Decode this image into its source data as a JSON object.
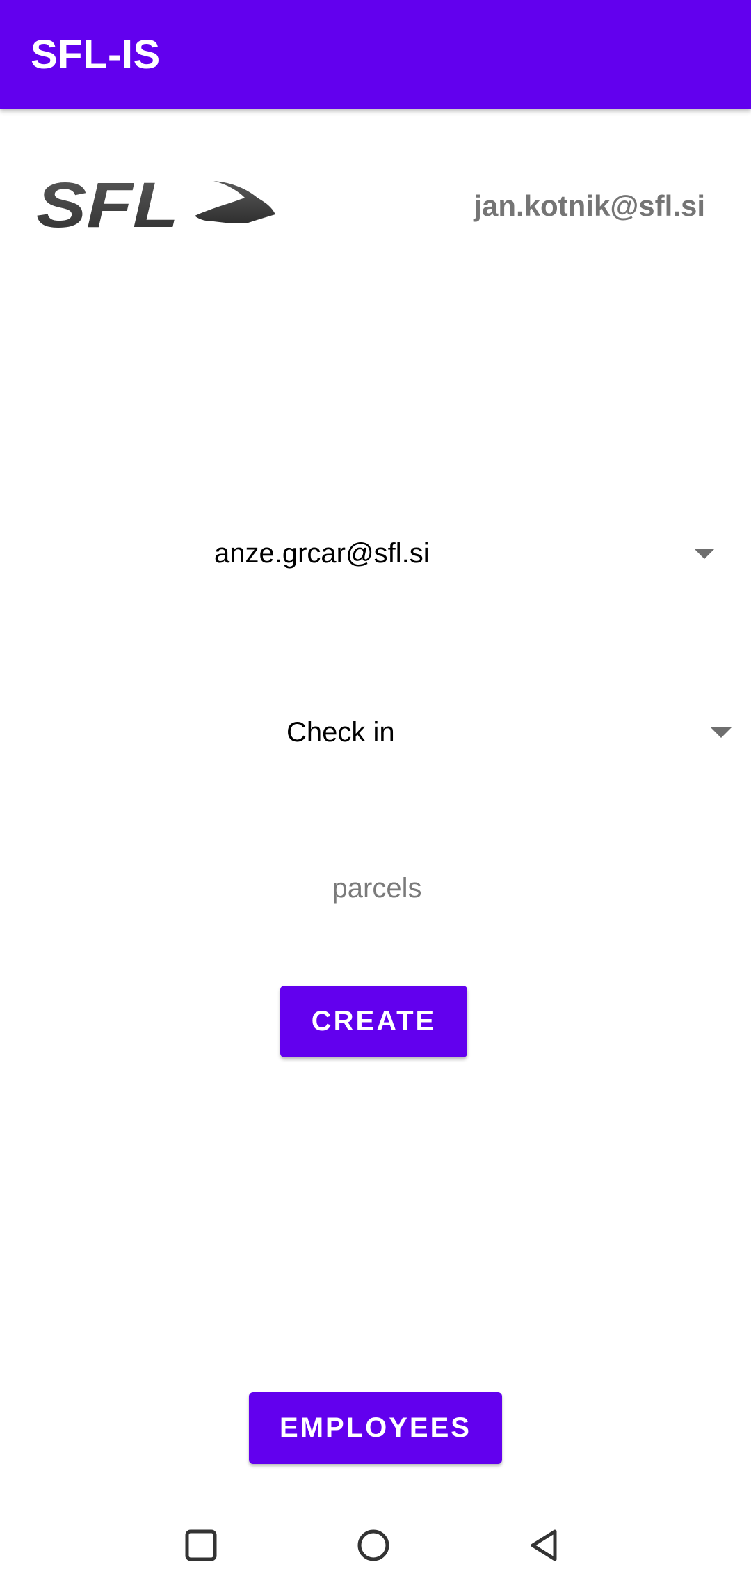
{
  "app_bar": {
    "title": "SFL-IS",
    "color": "#6200ee"
  },
  "header": {
    "logo_text": "SFL",
    "user_email": "jan.kotnik@sfl.si"
  },
  "form": {
    "employee_select": {
      "value": "anze.grcar@sfl.si"
    },
    "action_select": {
      "value": "Check in"
    },
    "parcels_input": {
      "placeholder": "parcels",
      "value": ""
    },
    "create_button_label": "CREATE"
  },
  "footer": {
    "employees_button_label": "EMPLOYEES"
  },
  "system_nav": {
    "recents": "square-icon",
    "home": "circle-icon",
    "back": "triangle-back-icon"
  }
}
